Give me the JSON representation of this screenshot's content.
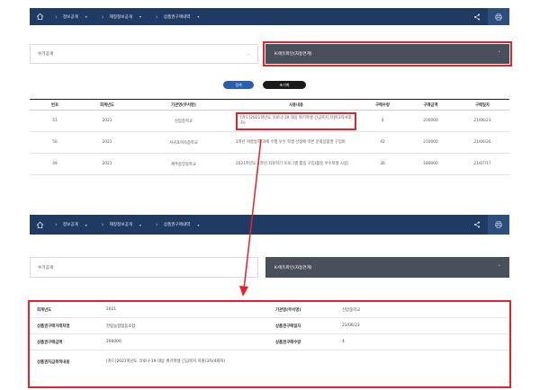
{
  "nav": {
    "home_icon": "home-icon",
    "crumbs": [
      {
        "label": "정보공개"
      },
      {
        "label": "제정정보공개"
      },
      {
        "label": "상품권구매내역"
      }
    ],
    "share_icon": "share-icon",
    "print_icon": "print-icon"
  },
  "filter": {
    "left_value": "수기공개",
    "left_arrow": "···",
    "right_value": "K-에듀파인(자동연계)",
    "right_arrow": "˅"
  },
  "buttons": {
    "search": "검색",
    "reset": "초기화"
  },
  "table": {
    "headers": [
      "번호",
      "회계년도",
      "기관명(부서명)",
      "사용내용",
      "구매수량",
      "구매금액",
      "구매일자"
    ],
    "rows": [
      {
        "no": "51",
        "year": "2021",
        "org": "신암중학교",
        "use": "[카드]2021학년도 코로나-19 대응 위기학생 긴급복지 지원(3차/4회차)",
        "qty": "4",
        "amount": "200000",
        "date": "21/06/23"
      },
      {
        "no": "50",
        "year": "2021",
        "org": "서귀포여자중학교",
        "use": "1학년 여름방학 과제 수행 우수 학생 선정에 따른 문화상품권 구입비",
        "qty": "42",
        "amount": "210000",
        "date": "21/06/26"
      },
      {
        "no": "49",
        "year": "2021",
        "org": "제주중앙중학교",
        "use": "2021학년도 1학년 자유학기 프로그램 활동 구입(활동 우수학생 시상)",
        "qty": "36",
        "amount": "180000",
        "date": "21/07/17"
      }
    ]
  },
  "filter2": {
    "left_value": "수기공개",
    "left_arrow": "···",
    "right_value": "K-에듀파인(자동연계)",
    "right_arrow": "˅"
  },
  "detail": {
    "year_label": "회계년도",
    "year_value": "2021",
    "org_label": "기관명(부서명)",
    "org_value": "신암중학교",
    "vendor_label": "상품권구매거래처명",
    "vendor_value": "한림농협협동조합",
    "date_label": "상품권구매일자",
    "date_value": "21/06/23",
    "amount_label": "상품권구매금액",
    "amount_value": "200000",
    "qty_label": "상품권구매수량",
    "qty_value": "4",
    "use_label": "상품권지급목적내용",
    "use_value": "[카드]2021학년도 코로나-19 대응 위기학생 긴급복지 지원(3차/4회차)"
  },
  "colors": {
    "nav_bg": "#1f3a63",
    "highlight": "#e2232a",
    "search_btn": "#2a5fb0",
    "dark_select": "#4a4f5c"
  }
}
